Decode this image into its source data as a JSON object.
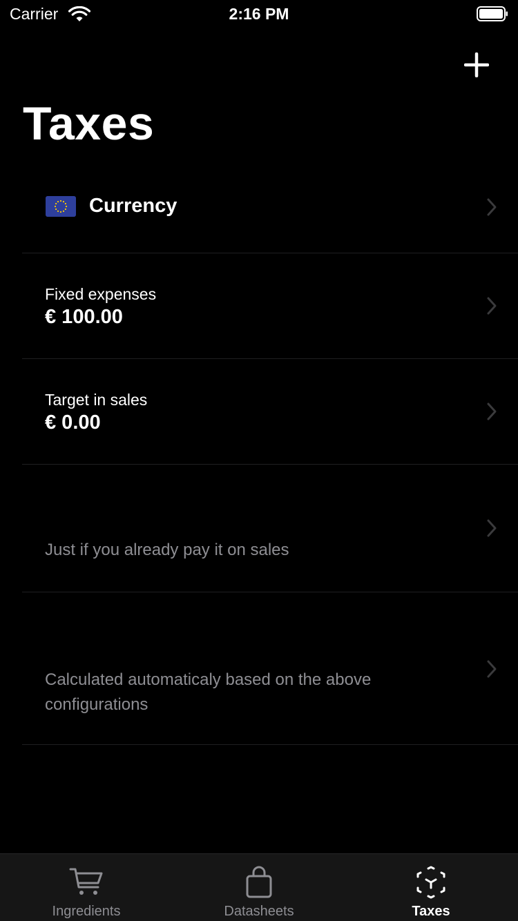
{
  "status_bar": {
    "carrier": "Carrier",
    "time": "2:16 PM"
  },
  "nav": {
    "title": "Taxes",
    "add_icon": "plus-icon"
  },
  "rows": {
    "currency": {
      "label": "Currency",
      "icon": "eu-flag-icon"
    },
    "fixed_expenses": {
      "label": "Fixed expenses",
      "value": "€ 100.00"
    },
    "target_in_sales": {
      "label": "Target in sales",
      "value": "€ 0.00"
    },
    "sales_tax_note": {
      "note": "Just if you already pay it on sales"
    },
    "calculated_note": {
      "note": "Calculated automaticaly based on the above configurations"
    }
  },
  "tabs": [
    {
      "label": "Ingredients",
      "icon": "cart-icon",
      "active": false
    },
    {
      "label": "Datasheets",
      "icon": "bag-icon",
      "active": false
    },
    {
      "label": "Taxes",
      "icon": "cube-icon",
      "active": true
    }
  ],
  "colors": {
    "background": "#000000",
    "secondary_text": "#8e8e93",
    "tab_bar": "#161616",
    "flag_blue": "#2e3f9c",
    "flag_stars": "#ffcc00"
  }
}
